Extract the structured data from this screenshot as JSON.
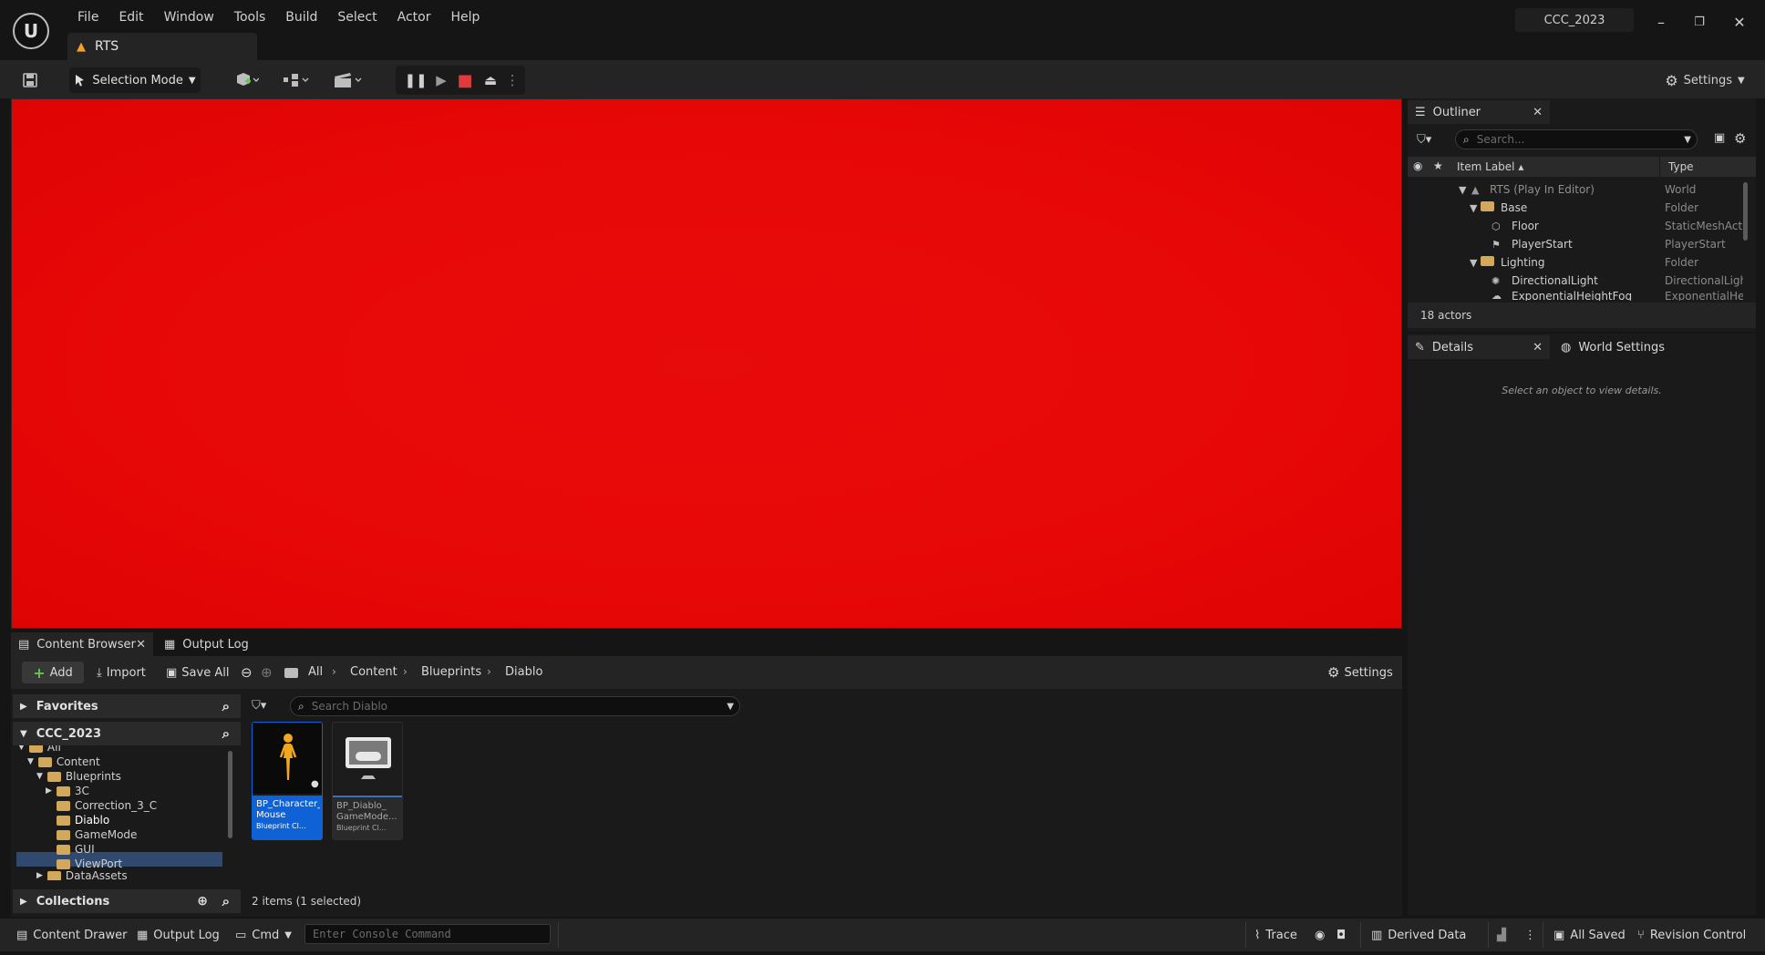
{
  "title_bar": {
    "logo_text": "U",
    "menu": [
      "File",
      "Edit",
      "Window",
      "Tools",
      "Build",
      "Select",
      "Actor",
      "Help"
    ],
    "level_tab": "RTS",
    "project_name": "CCC_2023",
    "window_controls": {
      "minimize": "–",
      "restore": "❐",
      "close": "✕"
    }
  },
  "toolbar": {
    "selection_mode": "Selection Mode",
    "settings": "Settings",
    "play_controls": {
      "pause": "❚❚",
      "step": "▶",
      "stop": "■",
      "eject": "⏏",
      "more": "⋮"
    }
  },
  "outliner": {
    "tab_label": "Outliner",
    "search_placeholder": "Search...",
    "col_label": "Item Label ▴",
    "col_type": "Type",
    "rows": [
      {
        "label": "RTS (Play In Editor)",
        "type": "World"
      },
      {
        "label": "Base",
        "type": "Folder"
      },
      {
        "label": "Floor",
        "type": "StaticMeshActor"
      },
      {
        "label": "PlayerStart",
        "type": "PlayerStart"
      },
      {
        "label": "Lighting",
        "type": "Folder"
      },
      {
        "label": "DirectionalLight",
        "type": "DirectionalLight"
      },
      {
        "label": "ExponentialHeightFog",
        "type": "ExponentialHeightFog"
      }
    ],
    "actor_count": "18 actors"
  },
  "details": {
    "tab_label": "Details",
    "world_settings_tab": "World Settings",
    "empty_message": "Select an object to view details."
  },
  "content_browser": {
    "tab_label": "Content Browser",
    "output_log_tab": "Output Log",
    "add_label": "Add",
    "import_label": "Import",
    "save_all_label": "Save All",
    "settings_label": "Settings",
    "breadcrumbs": [
      "All",
      "Content",
      "Blueprints",
      "Diablo"
    ],
    "favorites_label": "Favorites",
    "project_label": "CCC_2023",
    "collections_label": "Collections",
    "folders": [
      "All",
      "Content",
      "Blueprints",
      "3C",
      "Correction_3_C",
      "Diablo",
      "GameMode",
      "GUI",
      "ViewPort",
      "DataAssets"
    ],
    "search_placeholder": "Search Diablo",
    "assets": [
      {
        "name1": "BP_Character_",
        "name2": "Mouse",
        "kind": "Blueprint Cl..."
      },
      {
        "name1": "BP_Diablo_",
        "name2": "GameMode...",
        "kind": "Blueprint Cl..."
      }
    ],
    "items_count": "2 items (1 selected)"
  },
  "status_bar": {
    "content_drawer": "Content Drawer",
    "output_log": "Output Log",
    "cmd": "Cmd",
    "console_placeholder": "Enter Console Command",
    "trace": "Trace",
    "derived_data": "Derived Data",
    "all_saved": "All Saved",
    "revision_control": "Revision Control"
  },
  "colors": {
    "viewport": "#e70707",
    "selection": "#0f62d6",
    "folder": "#d3a85a",
    "add_plus": "#69c24e",
    "stop": "#e03a3a"
  }
}
